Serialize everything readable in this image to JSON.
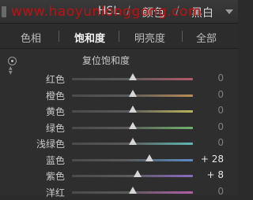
{
  "watermark": "www.haoyunlonggong.com",
  "header": {
    "tabs": [
      "HSL",
      "颜色",
      "黑白"
    ],
    "separator": "/"
  },
  "subtabs": [
    {
      "label": "色相",
      "active": false
    },
    {
      "label": "饱和度",
      "active": true
    },
    {
      "label": "明亮度",
      "active": false
    },
    {
      "label": "全部",
      "active": false
    }
  ],
  "reset_label": "复位饱和度",
  "sliders": [
    {
      "label": "红色",
      "value": "0",
      "level": 0,
      "track_color": "#b25a6a"
    },
    {
      "label": "橙色",
      "value": "0",
      "level": 0,
      "track_color": "#b98a55"
    },
    {
      "label": "黄色",
      "value": "0",
      "level": 0,
      "track_color": "#b9b65a"
    },
    {
      "label": "绿色",
      "value": "0",
      "level": 0,
      "track_color": "#6fb36a"
    },
    {
      "label": "浅绿色",
      "value": "0",
      "level": 0,
      "track_color": "#5fb7b3"
    },
    {
      "label": "蓝色",
      "value": "+ 28",
      "level": 28,
      "track_color": "#5a8cc6"
    },
    {
      "label": "紫色",
      "value": "+ 8",
      "level": 8,
      "track_color": "#8a6ac0"
    },
    {
      "label": "洋红",
      "value": "0",
      "level": 0,
      "track_color": "#b35fa8"
    }
  ],
  "colors": {
    "panel_bg": "#2e2e2e",
    "watermark": "#c01010",
    "active_tab": "#f2f2f2"
  }
}
